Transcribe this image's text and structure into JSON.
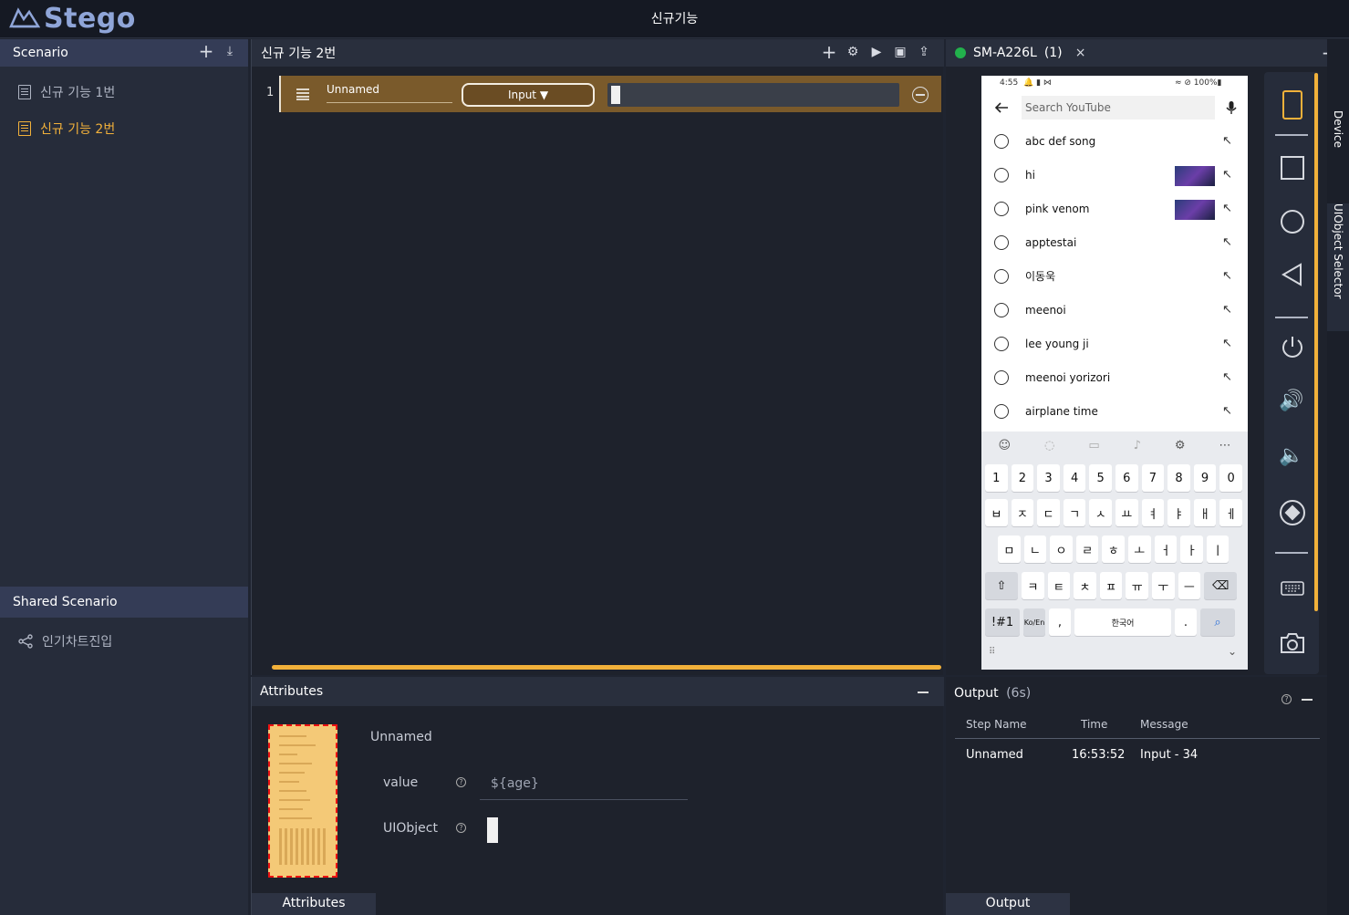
{
  "app": {
    "logo": "Stego",
    "title": "신규기능"
  },
  "scenario": {
    "header": "Scenario",
    "items": [
      {
        "label": "신규 기능 1번",
        "active": false
      },
      {
        "label": "신규 기능 2번",
        "active": true
      }
    ]
  },
  "shared": {
    "header": "Shared Scenario",
    "items": [
      {
        "label": "인기차트진입"
      }
    ]
  },
  "editor": {
    "title": "신규 기능 2번",
    "steps": [
      {
        "num": "1",
        "name": "Unnamed",
        "type": "Input ▼"
      }
    ]
  },
  "attributes": {
    "header": "Attributes",
    "name": "Unnamed",
    "value_label": "value",
    "value": "${age}",
    "uiobject_label": "UIObject",
    "tab": "Attributes"
  },
  "device": {
    "title": "SM-A226L",
    "count": "(1)",
    "status_time": "4:55",
    "status_icons": "🔔 ▮ ⋈",
    "status_right": "≈ ⊘ 100%▮",
    "search_placeholder": "Search YouTube",
    "suggestions": [
      {
        "text": "abc def song",
        "kind": "history",
        "thumb": false
      },
      {
        "text": "hi",
        "kind": "history",
        "thumb": true
      },
      {
        "text": "pink venom",
        "kind": "history",
        "thumb": true
      },
      {
        "text": "apptestai",
        "kind": "history",
        "thumb": false
      },
      {
        "text": "이동욱",
        "kind": "search",
        "thumb": false
      },
      {
        "text": "meenoi",
        "kind": "search",
        "thumb": false
      },
      {
        "text": "lee young ji",
        "kind": "search",
        "thumb": false
      },
      {
        "text": "meenoi yorizori",
        "kind": "search",
        "thumb": false
      },
      {
        "text": "airplane time",
        "kind": "search",
        "thumb": false
      }
    ],
    "keyboard": {
      "row1": [
        "1",
        "2",
        "3",
        "4",
        "5",
        "6",
        "7",
        "8",
        "9",
        "0"
      ],
      "row2": [
        "ㅂ",
        "ㅈ",
        "ㄷ",
        "ㄱ",
        "ㅅ",
        "ㅛ",
        "ㅕ",
        "ㅑ",
        "ㅐ",
        "ㅔ"
      ],
      "row3": [
        "ㅁ",
        "ㄴ",
        "ㅇ",
        "ㄹ",
        "ㅎ",
        "ㅗ",
        "ㅓ",
        "ㅏ",
        "ㅣ"
      ],
      "row4": [
        "ㅋ",
        "ㅌ",
        "ㅊ",
        "ㅍ",
        "ㅠ",
        "ㅜ",
        "ㅡ"
      ],
      "sym": "!#1",
      "lang": "Ko/En",
      "comma": ",",
      "space": "한국어",
      "dot": "."
    }
  },
  "side_tabs": [
    "Device",
    "UIObject Selector"
  ],
  "output": {
    "header": "Output",
    "elapsed": "(6s)",
    "columns": [
      "Step Name",
      "Time",
      "Message"
    ],
    "rows": [
      {
        "step": "Unnamed",
        "time": "16:53:52",
        "message": "Input - 34"
      }
    ],
    "tab": "Output"
  },
  "colors": {
    "accent": "#f2b13a",
    "step_bg": "#7a5a2b",
    "connected": "#22b14c",
    "logo": "#8fa5d8"
  }
}
